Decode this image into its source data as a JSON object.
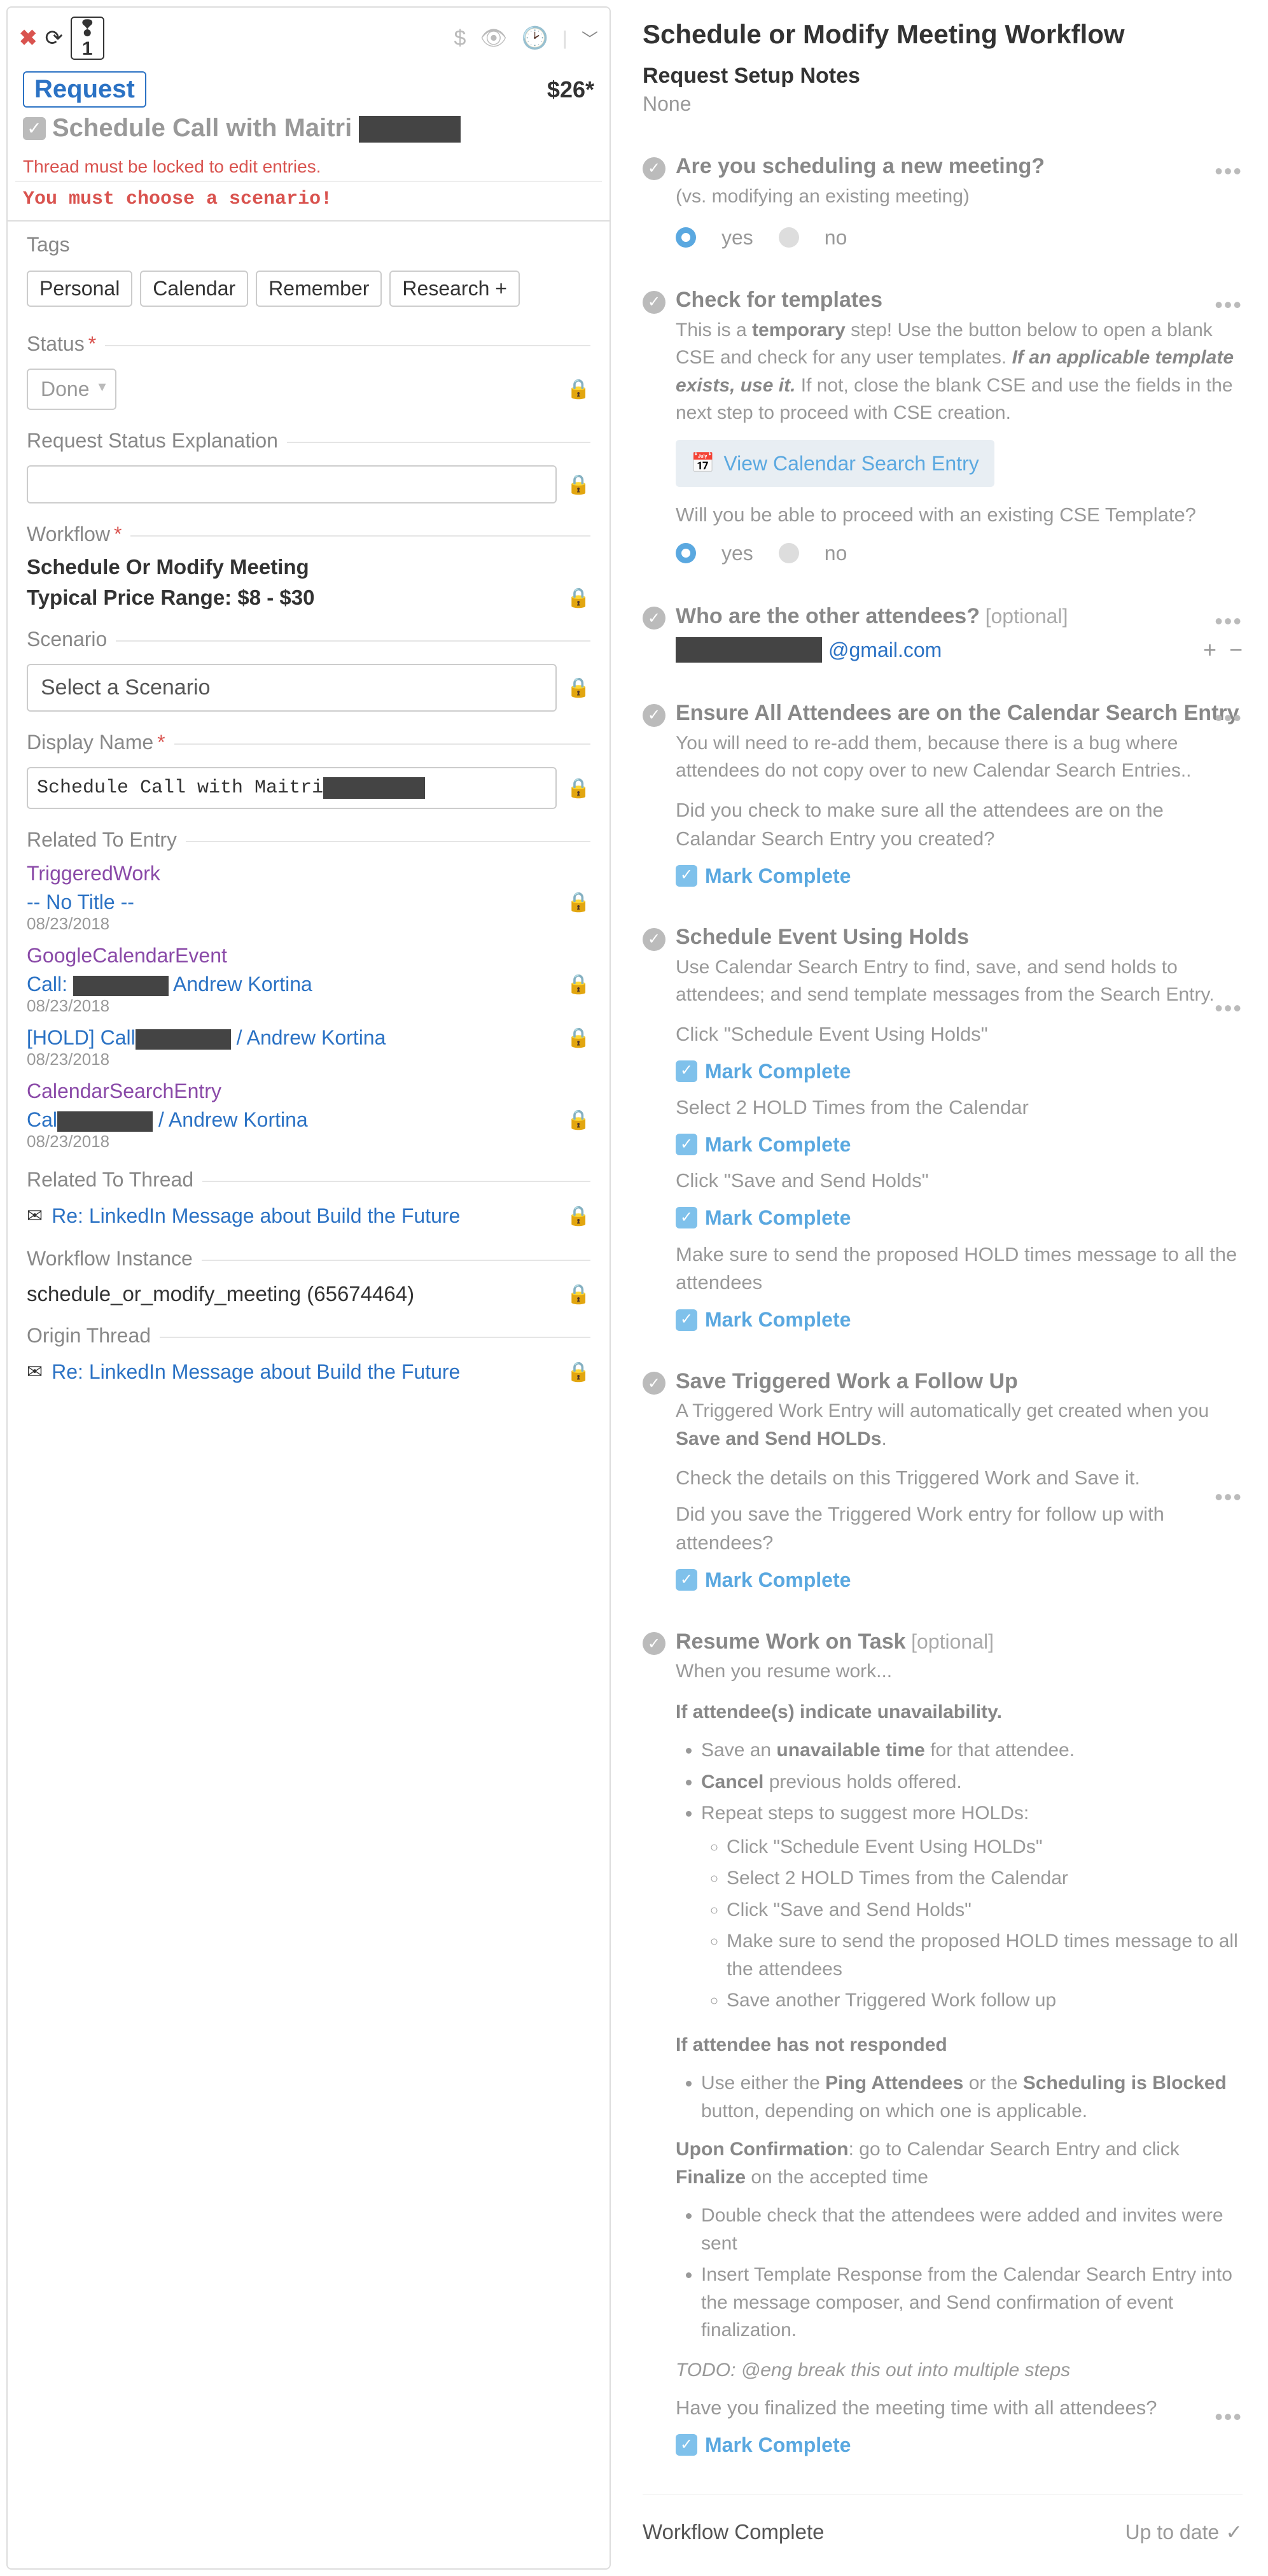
{
  "left": {
    "alert_count": "1",
    "price": "$26*",
    "request_badge": "Request",
    "title_prefix": "Schedule Call with Maitri ",
    "warn_locked": "Thread must be locked to edit entries.",
    "warn_scenario": "You must choose a scenario!",
    "tags_label": "Tags",
    "tags": [
      "Personal",
      "Calendar",
      "Remember",
      "Research +"
    ],
    "status_label": "Status",
    "status_value": "Done",
    "rse_label": "Request Status Explanation",
    "workflow_label": "Workflow",
    "workflow_name": "Schedule Or Modify Meeting",
    "price_range": "Typical Price Range: $8 - $30",
    "scenario_label": "Scenario",
    "scenario_placeholder": "Select a Scenario",
    "display_name_label": "Display Name",
    "display_name_value": "Schedule Call with Maitri ",
    "related_entry_label": "Related To Entry",
    "triggered_work": "TriggeredWork",
    "no_title": "-- No Title --",
    "date": "08/23/2018",
    "gce": "GoogleCalendarEvent",
    "call_prefix": "Call: ",
    "andrew": " Andrew Kortina",
    "hold_prefix": "[HOLD] Call",
    "hold_suffix": " / Andrew Kortina",
    "cse": "CalendarSearchEntry",
    "cal_prefix": "Cal",
    "cal_suffix": " / Andrew Kortina",
    "related_thread_label": "Related To Thread",
    "thread_link": "Re: LinkedIn Message about Build the Future",
    "wi_label": "Workflow Instance",
    "wi_value": "schedule_or_modify_meeting (65674464)",
    "origin_label": "Origin Thread"
  },
  "right": {
    "title": "Schedule or Modify Meeting Workflow",
    "setup_label": "Request Setup Notes",
    "setup_value": "None",
    "yes": "yes",
    "no": "no",
    "mark_complete": "Mark Complete",
    "s1": {
      "title": "Are you scheduling a new meeting?",
      "desc": "(vs. modifying an existing meeting)"
    },
    "s2": {
      "title": "Check for templates",
      "desc_pre": "This is a ",
      "temp": "temporary",
      "desc_mid": " step! Use the button below to open a blank CSE and check for any user templates. ",
      "bold": "If an applicable template exists, use it.",
      "desc_post": " If not, close the blank CSE and use the fields in the next step to proceed with CSE creation.",
      "btn": "View Calendar Search Entry",
      "q": "Will you be able to proceed with an existing CSE Template?"
    },
    "s3": {
      "title": "Who are the other attendees?",
      "opt": "[optional]",
      "email_suffix": "@gmail.com"
    },
    "s4": {
      "title": "Ensure All Attendees are on the Calendar Search Entry",
      "desc": "You will need to re-add them, because there is a bug where attendees do not copy over to new Calendar Search Entries..",
      "q": "Did you check to make sure all the attendees are on the Calandar Search Entry you created?"
    },
    "s5": {
      "title": "Schedule Event Using Holds",
      "desc": "Use Calendar Search Entry to find, save, and send holds to attendees; and send template messages from the Search Entry.",
      "t1": "Click \"Schedule Event Using Holds\"",
      "t2": "Select 2 HOLD Times from the Calendar",
      "t3": "Click \"Save and Send Holds\"",
      "t4": "Make sure to send the proposed HOLD times message to all the attendees"
    },
    "s6": {
      "title": "Save Triggered Work a Follow Up",
      "desc_pre": "A Triggered Work Entry will automatically get created when you ",
      "bold": "Save and Send HOLDs",
      "desc_post": ".",
      "sub": "Check the details on this Triggered Work and Save it.",
      "q": "Did you save the Triggered Work entry for follow up with attendees?"
    },
    "s7": {
      "title": "Resume Work on Task",
      "opt": "[optional]",
      "desc": "When you resume work...",
      "h1": "If attendee(s) indicate unavailability.",
      "b1_pre": "Save an ",
      "b1_bold": "unavailable time",
      "b1_post": " for that attendee.",
      "b2_bold": "Cancel",
      "b2_post": " previous holds offered.",
      "b3": "Repeat steps to suggest more HOLDs:",
      "sub1": "Click \"Schedule Event Using HOLDs\"",
      "sub2": "Select 2 HOLD Times from the Calendar",
      "sub3": "Click \"Save and Send Holds\"",
      "sub4": "Make sure to send the proposed HOLD times message to all the attendees",
      "sub5": "Save another Triggered Work follow up",
      "h2": "If attendee has not responded",
      "c1_pre": "Use either the ",
      "c1_b1": "Ping Attendees",
      "c1_mid": " or the ",
      "c1_b2": "Scheduling is Blocked",
      "c1_post": " button, depending on which one is applicable.",
      "h3_pre": "Upon Confirmation",
      "h3_mid": ": go to Calendar Search Entry and click ",
      "h3_bold": "Finalize",
      "h3_post": " on the accepted time",
      "d1": "Double check that the attendees were added and invites were sent",
      "d2": "Insert Template Response from the Calendar Search Entry into the message composer, and Send confirmation of event finalization.",
      "todo": "TODO: @eng break this out into multiple steps",
      "q": "Have you finalized the meeting time with all attendees?"
    },
    "footer_l": "Workflow Complete",
    "footer_r": "Up to date"
  }
}
